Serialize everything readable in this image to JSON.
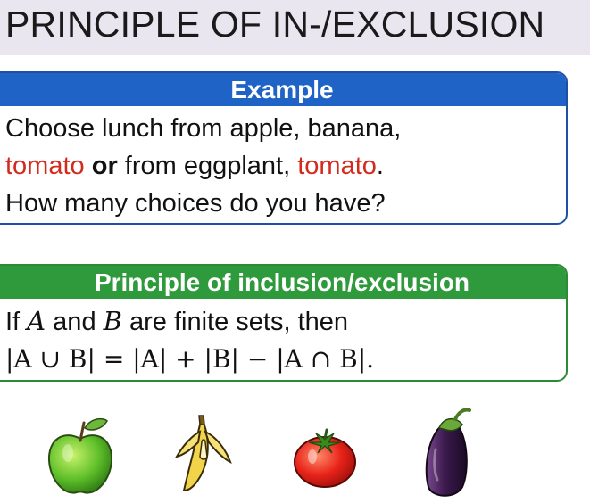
{
  "title": "PRINCIPLE OF IN-/EXCLUSION",
  "example": {
    "header": "Example",
    "line1": "Choose lunch from apple, banana,",
    "line2_a": "tomato",
    "line2_b": " or",
    "line2_c": " from eggplant, ",
    "line2_d": "tomato",
    "line2_e": ".",
    "line3": "How many choices do you have?"
  },
  "principle": {
    "header": "Principle of inclusion/exclusion",
    "if": "If ",
    "A": "A",
    "and": " and ",
    "B": "B",
    "rest": " are finite sets, then",
    "formula": "|A ∪ B| = |A| + |B| − |A ∩ B|."
  },
  "icons": [
    "apple-icon",
    "banana-icon",
    "tomato-icon",
    "eggplant-icon"
  ],
  "colors": {
    "example_header": "#1f63c6",
    "principle_header": "#2f9a3b",
    "highlight": "#d42a1e"
  }
}
